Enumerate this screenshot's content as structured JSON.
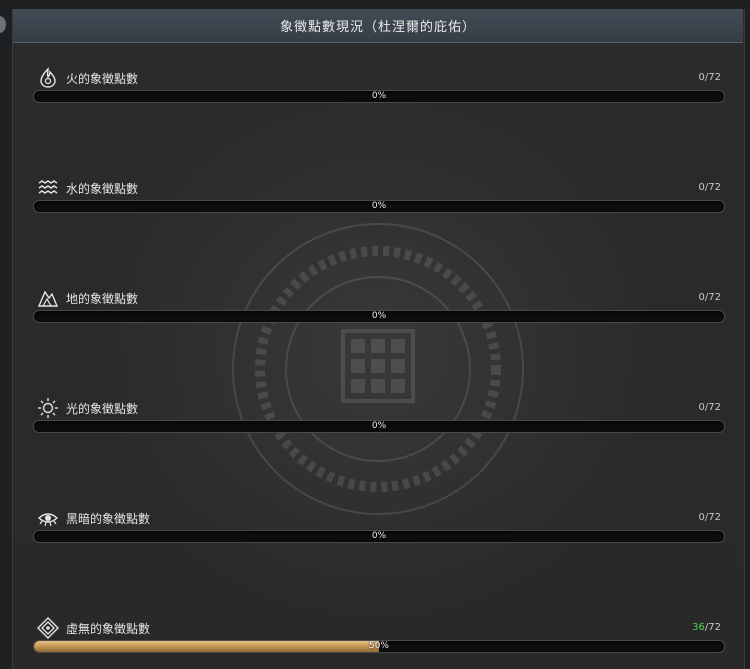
{
  "header": {
    "title": "象徵點數現況（杜涅爾的庇佑）"
  },
  "elements": [
    {
      "icon": "fire-icon",
      "label": "火的象徵點數",
      "current": "0",
      "max": "/72",
      "percent": 0
    },
    {
      "icon": "water-icon",
      "label": "水的象徵點數",
      "current": "0",
      "max": "/72",
      "percent": 0
    },
    {
      "icon": "earth-icon",
      "label": "地的象徵點數",
      "current": "0",
      "max": "/72",
      "percent": 0
    },
    {
      "icon": "light-icon",
      "label": "光的象徵點數",
      "current": "0",
      "max": "/72",
      "percent": 0
    },
    {
      "icon": "darkness-icon",
      "label": "黑暗的象徵點數",
      "current": "0",
      "max": "/72",
      "percent": 0
    },
    {
      "icon": "void-icon",
      "label": "虛無的象徵點數",
      "current": "36",
      "max": "/72",
      "percent": 50
    }
  ],
  "percent_labels": [
    "0%",
    "0%",
    "0%",
    "0%",
    "0%",
    "50%"
  ]
}
